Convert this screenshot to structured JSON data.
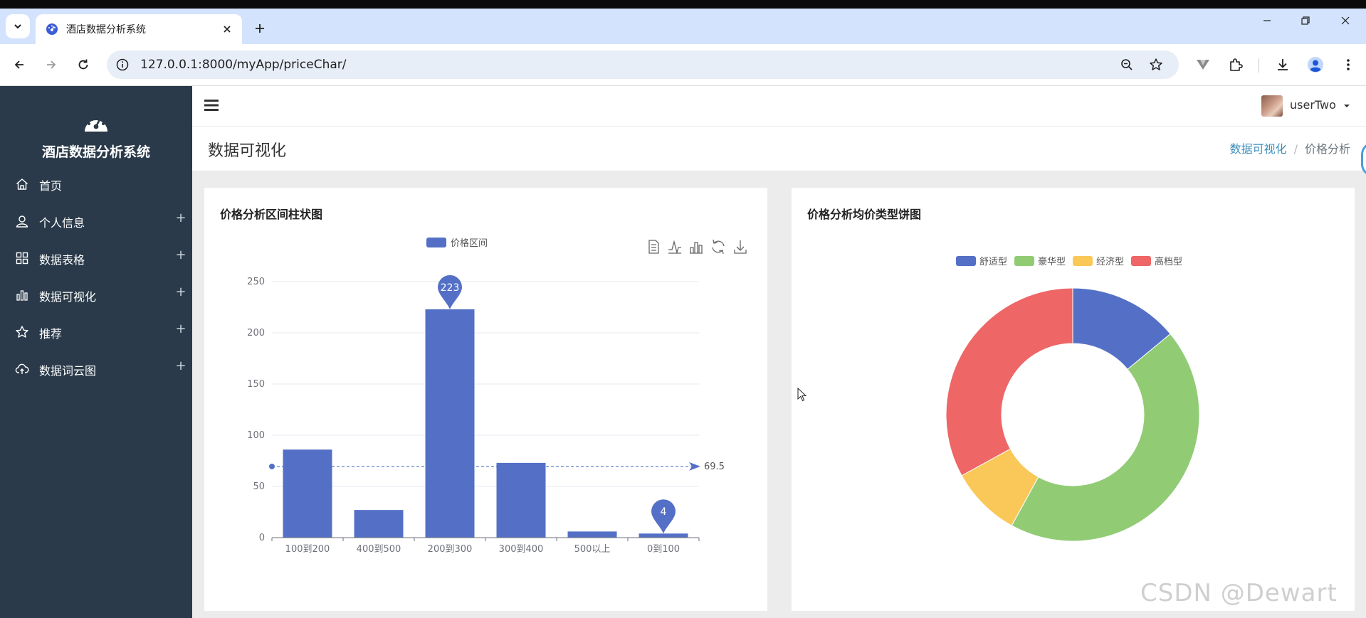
{
  "browser": {
    "tab_title": "酒店数据分析系统",
    "url": "127.0.0.1:8000/myApp/priceChar/"
  },
  "sidebar": {
    "brand": "酒店数据分析系统",
    "items": [
      {
        "label": "首页",
        "icon": "home-icon",
        "expandable": false
      },
      {
        "label": "个人信息",
        "icon": "user-icon",
        "expandable": true
      },
      {
        "label": "数据表格",
        "icon": "grid-icon",
        "expandable": true
      },
      {
        "label": "数据可视化",
        "icon": "bar-chart-icon",
        "expandable": true
      },
      {
        "label": "推荐",
        "icon": "star-icon",
        "expandable": true
      },
      {
        "label": "数据词云图",
        "icon": "cloud-upload-icon",
        "expandable": true
      }
    ],
    "plus": "+"
  },
  "header": {
    "username": "userTwo"
  },
  "page": {
    "title": "数据可视化",
    "breadcrumb": [
      "数据可视化",
      "价格分析"
    ],
    "breadcrumb_sep": "/"
  },
  "bar_card": {
    "title": "价格分析区间柱状图"
  },
  "pie_card": {
    "title": "价格分析均价类型饼图"
  },
  "watermark": "CSDN @Dewart",
  "colors": {
    "sidebar": "#2a3a4a",
    "bar_blue": "#5470c6",
    "green": "#91cc75",
    "yellow": "#fac858",
    "red": "#ee6666",
    "link": "#3c8dbc"
  },
  "chart_data": [
    {
      "type": "bar",
      "title": "价格分析区间柱状图",
      "legend": [
        "价格区间"
      ],
      "legend_position": "top-center",
      "categories": [
        "100到200",
        "400到500",
        "200到300",
        "300到400",
        "500以上",
        "0到100"
      ],
      "series": [
        {
          "name": "价格区间",
          "values": [
            86,
            27,
            223,
            73,
            6,
            4
          ]
        }
      ],
      "ylim": [
        0,
        250
      ],
      "yticks": [
        0,
        50,
        100,
        150,
        200,
        250
      ],
      "mark_points": [
        {
          "label": "223",
          "category": "200到300",
          "value": 223,
          "kind": "max"
        },
        {
          "label": "4",
          "category": "0到100",
          "value": 4,
          "kind": "min"
        }
      ],
      "mark_line": {
        "label": "69.5",
        "value": 69.5,
        "kind": "average"
      },
      "grid": true,
      "toolbox": [
        "data-view-icon",
        "line-chart-icon",
        "bar-chart-icon",
        "restore-icon",
        "download-icon"
      ]
    },
    {
      "type": "pie",
      "title": "价格分析均价类型饼图",
      "donut": true,
      "legend": [
        "舒适型",
        "豪华型",
        "经济型",
        "高档型"
      ],
      "legend_position": "top-center",
      "slices": [
        {
          "name": "舒适型",
          "value": 14
        },
        {
          "name": "豪华型",
          "value": 44
        },
        {
          "name": "经济型",
          "value": 9
        },
        {
          "name": "高档型",
          "value": 33
        }
      ]
    }
  ]
}
